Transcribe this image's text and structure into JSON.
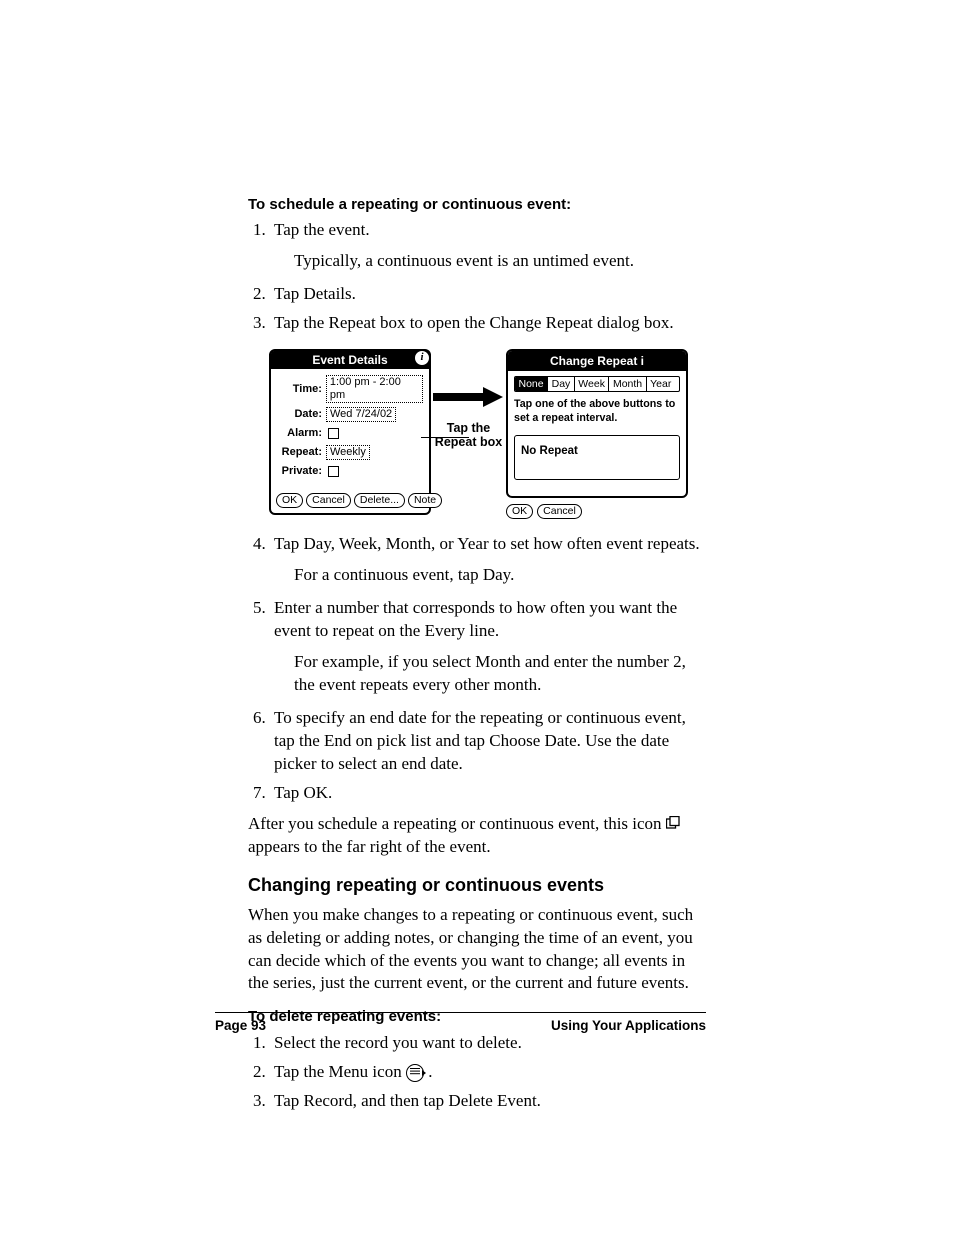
{
  "headings": {
    "schedule": "To schedule a repeating or continuous event:",
    "changing": "Changing repeating or continuous events",
    "delete": "To delete repeating events:"
  },
  "steps_a": {
    "s1": "Tap the event.",
    "s1_sub": "Typically, a continuous event is an untimed event.",
    "s2": "Tap Details.",
    "s3": "Tap the Repeat box to open the Change Repeat dialog box.",
    "s4": "Tap Day, Week, Month, or Year to set how often event repeats.",
    "s4_sub": "For a continuous event, tap Day.",
    "s5": "Enter a number that corresponds to how often you want the event to repeat on the Every line.",
    "s5_sub": "For example, if you select Month and enter the number 2, the event repeats every other month.",
    "s6": "To specify an end date for the repeating or continuous event, tap the End on pick list and tap Choose Date. Use the date picker to select an end date.",
    "s7": "Tap OK."
  },
  "after_para_a": "After you schedule a repeating or continuous event, this icon ",
  "after_para_b": " appears to the far right of the event.",
  "changing_para": "When you make changes to a repeating or continuous event, such as deleting or adding notes, or changing the time of an event, you can decide which of the events you want to change; all events in the series, just the current event, or the current and future events.",
  "steps_b": {
    "s1": "Select the record you want to delete.",
    "s2a": "Tap the Menu icon ",
    "s2b": ".",
    "s3": "Tap Record, and then tap Delete Event."
  },
  "event_details": {
    "title": "Event Details",
    "labels": {
      "time": "Time:",
      "date": "Date:",
      "alarm": "Alarm:",
      "repeat": "Repeat:",
      "private": "Private:"
    },
    "values": {
      "time": "1:00 pm - 2:00 pm",
      "date": "Wed 7/24/02",
      "repeat": "Weekly"
    },
    "buttons": {
      "ok": "OK",
      "cancel": "Cancel",
      "delete": "Delete...",
      "note": "Note"
    }
  },
  "arrow_caption": "Tap the Repeat box",
  "change_repeat": {
    "title": "Change Repeat",
    "tabs": {
      "none": "None",
      "day": "Day",
      "week": "Week",
      "month": "Month",
      "year": "Year"
    },
    "hint": "Tap one of the above buttons to set a repeat interval.",
    "no_repeat": "No Repeat",
    "buttons": {
      "ok": "OK",
      "cancel": "Cancel"
    }
  },
  "footer": {
    "left": "Page 93",
    "right": "Using Your Applications"
  }
}
